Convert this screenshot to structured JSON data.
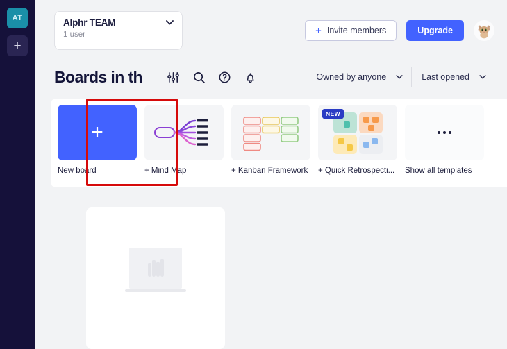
{
  "sidebar": {
    "team_avatar_initials": "AT",
    "add_team_icon": "plus-icon",
    "background_color": "#15113a",
    "avatar_color": "#1a8fa8"
  },
  "topbar": {
    "team_name": "Alphr TEAM",
    "team_users": "1 user",
    "team_caret_icon": "chevron-down-icon",
    "invite_label": "Invite members",
    "invite_plus_icon": "plus-icon",
    "upgrade_label": "Upgrade",
    "user_avatar_icon": "cat-avatar",
    "accent_color": "#4262ff"
  },
  "header": {
    "title": "Boards in th",
    "icons": [
      {
        "name": "filter-sliders-icon"
      },
      {
        "name": "search-icon"
      },
      {
        "name": "help-circle-icon"
      },
      {
        "name": "notification-bell-icon"
      }
    ],
    "filters": [
      {
        "label": "Owned by anyone",
        "caret": "chevron-down-icon"
      },
      {
        "label": "Last opened",
        "caret": "chevron-down-icon"
      }
    ]
  },
  "templates": {
    "items": [
      {
        "label": "New board",
        "icon": "plus-icon",
        "badge": ""
      },
      {
        "label": "+ Mind Map",
        "icon": "mind-map-icon",
        "badge": ""
      },
      {
        "label": "+ Kanban Framework",
        "icon": "kanban-icon",
        "badge": ""
      },
      {
        "label": "+ Quick Retrospecti...",
        "icon": "retrospective-icon",
        "badge": "NEW"
      },
      {
        "label": "Show all templates",
        "icon": "ellipsis-icon",
        "badge": ""
      }
    ]
  },
  "annotation": {
    "target": "New board",
    "color": "#d60a0a"
  },
  "boards": {
    "items": [
      {
        "thumbnail_icon": "miro-logo-placeholder"
      }
    ]
  }
}
